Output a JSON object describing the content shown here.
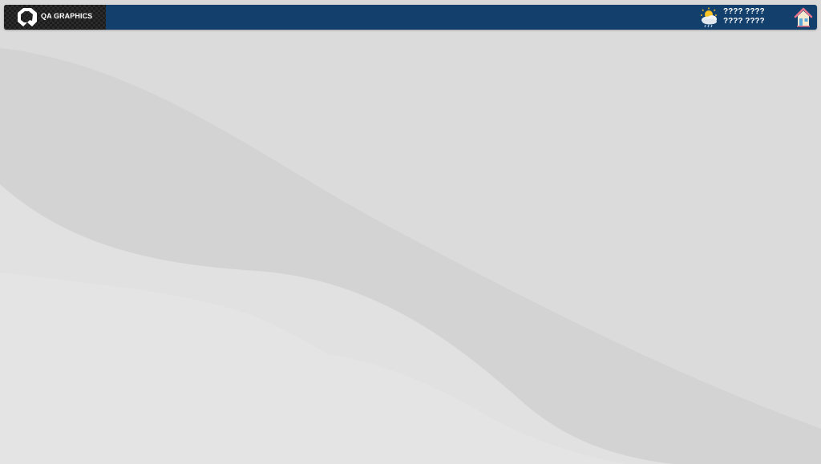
{
  "header": {
    "logo": {
      "text": "QA GRAPHICS",
      "icon": "qa-graphics-logo-icon"
    },
    "weather": {
      "icon": "partly-cloudy-rain-icon",
      "line1": "???? ????",
      "line2": "???? ????"
    },
    "home": {
      "icon": "home-icon"
    }
  },
  "colors": {
    "header_bar": "#123f6b",
    "logo_bg": "#1b1b1b",
    "background": "#dcdcdc"
  }
}
